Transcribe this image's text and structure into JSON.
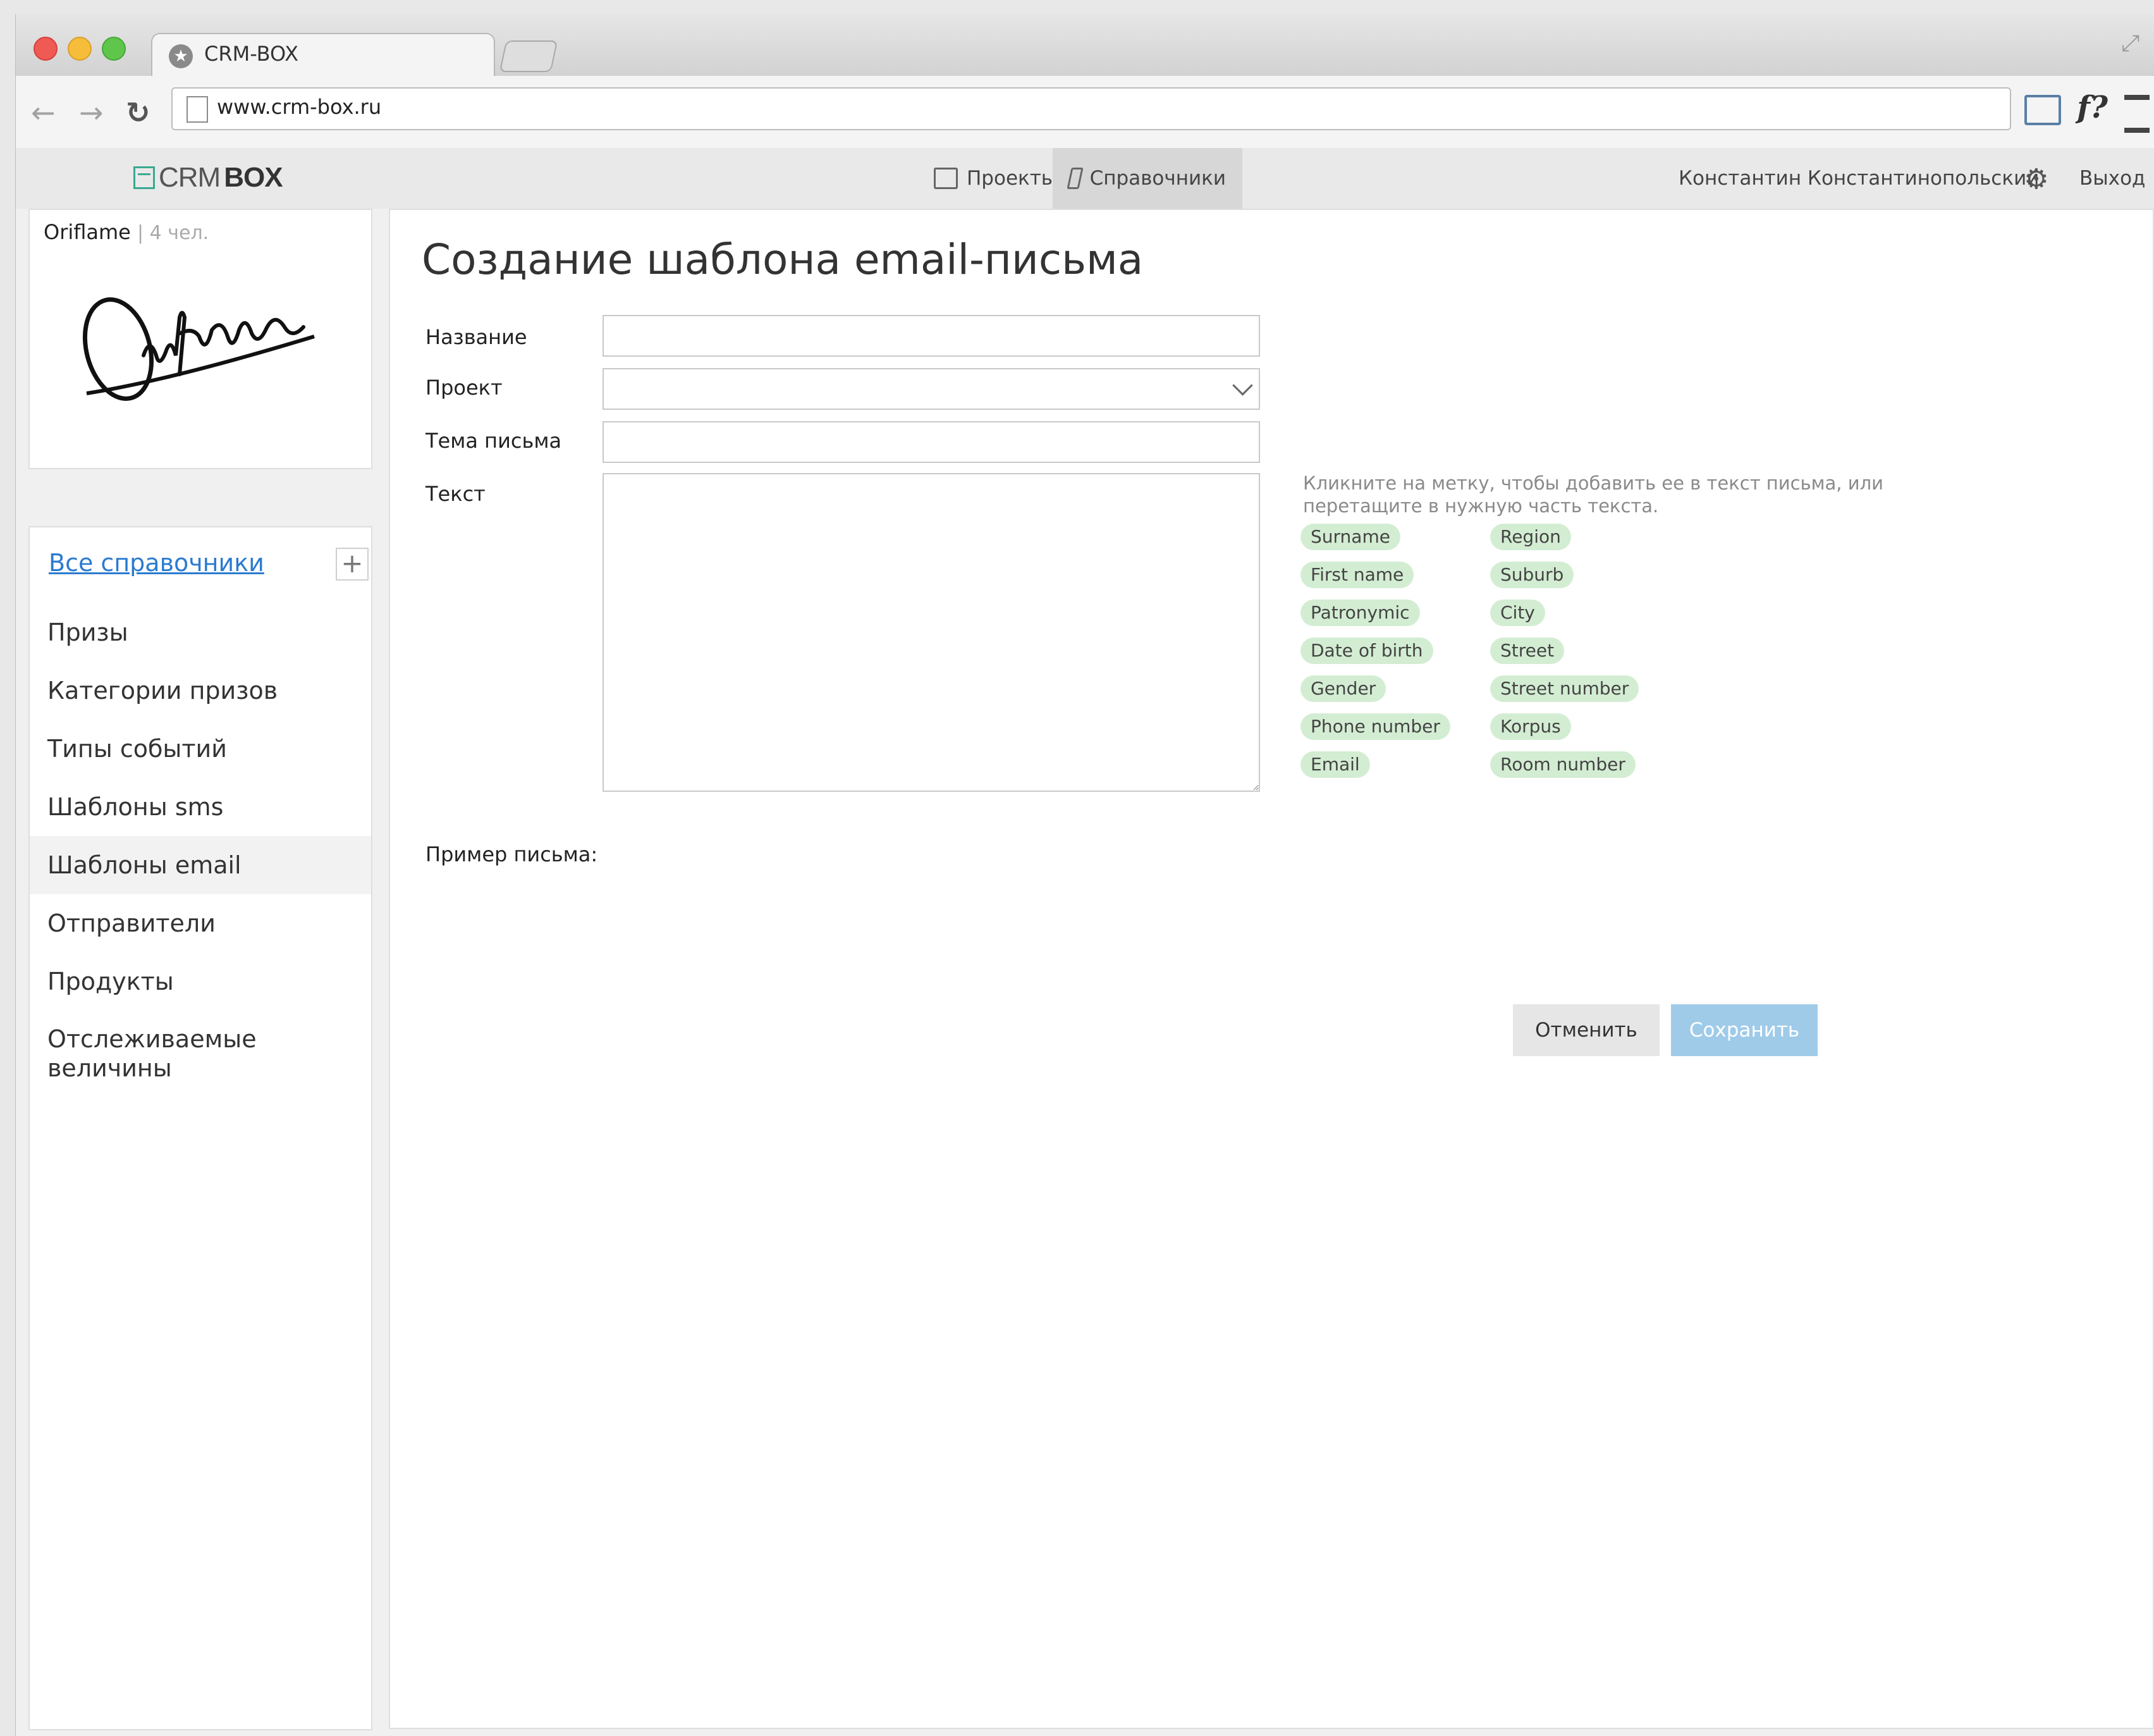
{
  "browser": {
    "tab_title": "CRM-BOX",
    "url": "www.crm-box.ru",
    "ext_label": "f?"
  },
  "app": {
    "logo_crm": "CRM",
    "logo_box": "BOX",
    "nav": {
      "projects": "Проекты",
      "references": "Справочники"
    },
    "user_name": "Константин Константинопольский",
    "logout": "Выход"
  },
  "org": {
    "name": "Oriflame",
    "count": "| 4 чел."
  },
  "sidebar": {
    "all_label": "Все справочники",
    "add_label": "+",
    "items": [
      {
        "label": "Призы"
      },
      {
        "label": "Категории призов"
      },
      {
        "label": "Типы событий"
      },
      {
        "label": "Шаблоны sms"
      },
      {
        "label": "Шаблоны email",
        "active": true
      },
      {
        "label": "Отправители"
      },
      {
        "label": "Продукты"
      },
      {
        "label": "Отслеживаемые величины"
      }
    ]
  },
  "form": {
    "title": "Создание шаблона email-письма",
    "name_label": "Название",
    "name_value": "",
    "project_label": "Проект",
    "project_value": "",
    "subject_label": "Тема письма",
    "subject_value": "",
    "text_label": "Текст",
    "text_value": "",
    "hint": "Кликните на метку, чтобы добавить ее в текст письма, или перетащите в нужную часть текста.",
    "tags_left": [
      "Surname",
      "First name",
      "Patronymic",
      "Date of birth",
      "Gender",
      "Phone number",
      "Email"
    ],
    "tags_right": [
      "Region",
      "Suburb",
      "City",
      "Street",
      "Street number",
      "Korpus",
      "Room number"
    ],
    "example_label": "Пример письма:",
    "cancel_label": "Отменить",
    "save_label": "Сохранить"
  }
}
